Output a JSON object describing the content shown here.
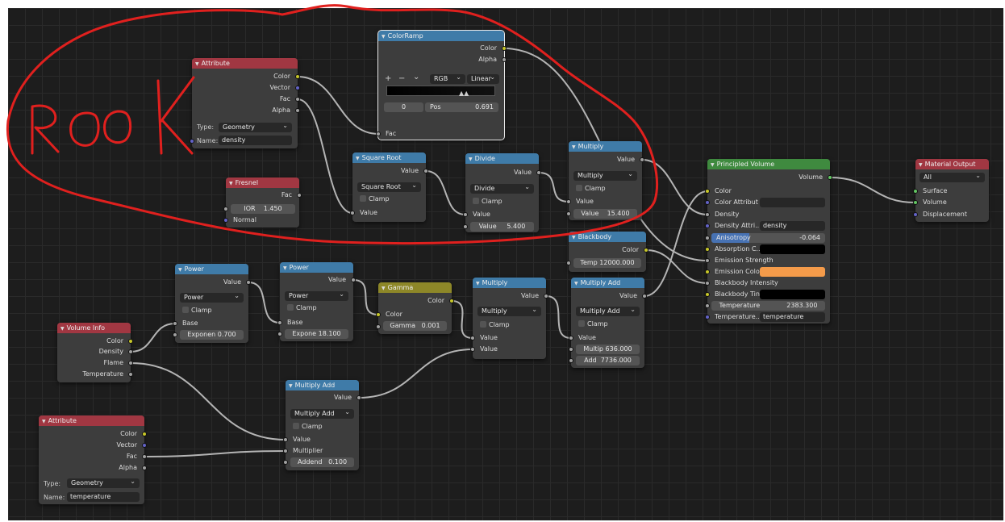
{
  "annotation": {
    "text": "ROOK",
    "color": "#e0201e"
  },
  "colors": {
    "attribute_header": "#a13742",
    "math_header": "#3f7ba8",
    "shader_header": "#3f8a3f",
    "gamma_header": "#8d8728",
    "socket_color": "#c7c729",
    "socket_value": "#a1a1a1",
    "socket_vector": "#6363c7",
    "socket_shader": "#63c763",
    "emission_color": "#f49b4a",
    "anisotropy_bar": "#4772b3"
  },
  "common": {
    "clamp": "Clamp",
    "value": "Value",
    "type_label": "Type:",
    "name_label": "Name:"
  },
  "attribute_top": {
    "title": "Attribute",
    "outputs": [
      "Color",
      "Vector",
      "Fac",
      "Alpha"
    ],
    "type": "Geometry",
    "name": "density"
  },
  "colorramp": {
    "title": "ColorRamp",
    "outputs": [
      "Color",
      "Alpha"
    ],
    "plus": "+",
    "minus": "−",
    "menu": "⌄",
    "mode": "RGB",
    "interp": "Linear",
    "index": "0",
    "pos_label": "Pos",
    "pos_value": "0.691",
    "input": "Fac"
  },
  "fresnel": {
    "title": "Fresnel",
    "output": "Fac",
    "ior_label": "IOR",
    "ior_value": "1.450",
    "input": "Normal"
  },
  "sqrt": {
    "title": "Square Root",
    "output": "Value",
    "operation": "Square Root",
    "input": "Value"
  },
  "divide": {
    "title": "Divide",
    "output": "Value",
    "operation": "Divide",
    "input": "Value",
    "value_label": "Value",
    "value": "5.400"
  },
  "multiply_top": {
    "title": "Multiply",
    "output": "Value",
    "operation": "Multiply",
    "input": "Value",
    "value_label": "Value",
    "value": "15.400"
  },
  "blackbody": {
    "title": "Blackbody",
    "output": "Color",
    "temp_label": "Temp",
    "temp_value": "12000.000"
  },
  "principled": {
    "title": "Principled Volume",
    "output": "Volume",
    "inputs": {
      "color": "Color",
      "color_attr": "Color Attribut",
      "density": "Density",
      "density_attr": "Density Attri...",
      "density_attr_value": "density",
      "anisotropy": "Anisotropy",
      "anisotropy_value": "-0.064",
      "anisotropy_fraction": 0.33,
      "absorption": "Absorption C...",
      "emission_strength": "Emission Strength",
      "emission_color": "Emission Colo",
      "blackbody_intensity": "Blackbody Intensity",
      "blackbody_tint": "Blackbody Tint",
      "temperature": "Temperature",
      "temperature_value": "2383.300",
      "temperature_attr": "Temperature...",
      "temperature_attr_value": "temperature"
    }
  },
  "material_output": {
    "title": "Material Output",
    "target": "All",
    "inputs": [
      "Surface",
      "Volume",
      "Displacement"
    ]
  },
  "power1": {
    "title": "Power",
    "output": "Value",
    "operation": "Power",
    "input": "Base",
    "exp_label": "Exponen",
    "exp_value": "0.700"
  },
  "power2": {
    "title": "Power",
    "output": "Value",
    "operation": "Power",
    "input": "Base",
    "exp_label": "Expone",
    "exp_value": "18.100"
  },
  "gamma": {
    "title": "Gamma",
    "output": "Color",
    "input": "Color",
    "gamma_label": "Gamma",
    "gamma_value": "0.001"
  },
  "multiply_mid": {
    "title": "Multiply",
    "output": "Value",
    "operation": "Multiply",
    "inputs": [
      "Value",
      "Value"
    ]
  },
  "multiply_add_top": {
    "title": "Multiply Add",
    "output": "Value",
    "operation": "Multiply Add",
    "input": "Value",
    "mult_label": "Multip",
    "mult_value": "636.000",
    "add_label": "Add",
    "add_value": "7736.000"
  },
  "volume_info": {
    "title": "Volume Info",
    "outputs": [
      "Color",
      "Density",
      "Flame",
      "Temperature"
    ]
  },
  "multiply_add_bottom": {
    "title": "Multiply Add",
    "output": "Value",
    "operation": "Multiply Add",
    "inputs": [
      "Value",
      "Multiplier"
    ],
    "addend_label": "Addend",
    "addend_value": "0.100"
  },
  "attribute_bottom": {
    "title": "Attribute",
    "outputs": [
      "Color",
      "Vector",
      "Fac",
      "Alpha"
    ],
    "type": "Geometry",
    "name": "temperature"
  }
}
